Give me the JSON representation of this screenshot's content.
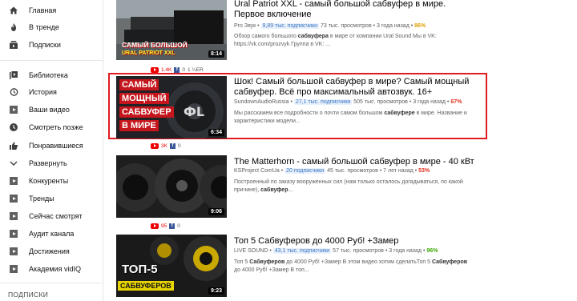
{
  "sidebar": {
    "items": [
      {
        "label": "Главная",
        "icon": "home-icon"
      },
      {
        "label": "В тренде",
        "icon": "fire-icon"
      },
      {
        "label": "Подписки",
        "icon": "subscriptions-icon"
      },
      {
        "label": "Библиотека",
        "icon": "library-icon"
      },
      {
        "label": "История",
        "icon": "history-icon"
      },
      {
        "label": "Ваши видео",
        "icon": "your-videos-icon"
      },
      {
        "label": "Смотреть позже",
        "icon": "clock-icon"
      },
      {
        "label": "Понравившиеся",
        "icon": "thumbs-up-icon"
      },
      {
        "label": "Развернуть",
        "icon": "chevron-down-icon"
      },
      {
        "label": "Конкуренты",
        "icon": "play-square-icon"
      },
      {
        "label": "Тренды",
        "icon": "play-square-icon"
      },
      {
        "label": "Сейчас смотрят",
        "icon": "play-square-icon"
      },
      {
        "label": "Аудит канала",
        "icon": "play-square-icon"
      },
      {
        "label": "Достижения",
        "icon": "play-square-icon"
      },
      {
        "label": "Академия vidIQ",
        "icon": "play-square-icon"
      }
    ],
    "subscriptions_heading": "ПОДПИСКИ"
  },
  "results": [
    {
      "title": "Ural Patriot XXL - самый большой сабвуфер в мире. Первое включение",
      "channel": "Pro Звук",
      "subs": "9,89 тыс. подписчики",
      "views": "73 тыс. просмотров",
      "age": "3 года назад",
      "score": "86%",
      "score_color": "#e0a000",
      "description": "Обзор самого большого <b>сабвуфера</b> в мире от компании Ural Sound Мы в VK: https://vk.com/prozvyk Группа в VK: ...",
      "duration": "8:14",
      "thumb_caption_1": "САМЫЙ БОЛЬШОЙ",
      "thumb_caption_2": "URAL PATRIOT XXL",
      "yt_count": "1.4K",
      "fb_count": "0",
      "extra": "1 ¼ER"
    },
    {
      "title": "Шок! Самый большой сабвуфер в мире? Самый мощный сабвуфер. Всё про максимальный автозвук. 16+",
      "channel": "SundownAudioRussia",
      "subs": "27,1 тыс. подписчики",
      "views": "505 тыс. просмотров",
      "age": "3 года назад",
      "score": "67%",
      "score_color": "#e0301e",
      "description": "Мы расскажем все подробности о почти самом большом <b>сабвуфере</b> в мире. Название и характеристики модели...",
      "duration": "6:34",
      "thumb_caption_1": "САМЫЙ",
      "thumb_caption_2": "МОЩНЫЙ",
      "thumb_caption_3": "САБВУФЕР",
      "thumb_caption_4": "В МИРЕ",
      "yt_count": "3K",
      "fb_count": "0"
    },
    {
      "title": "The Matterhorn - самый большой сабвуфер в мире - 40 кВт",
      "channel": "KSProject ComUa",
      "subs": "20 подписчики",
      "views": "45 тыс. просмотров",
      "age": "7 лет назад",
      "score": "53%",
      "score_color": "#e0301e",
      "description": "Построенный по заказу вооруженных сил (нам только осталось догадываться, по какой причине), <b>сабвуфер</b>...",
      "duration": "9:06",
      "yt_count": "95",
      "fb_count": "0"
    },
    {
      "title": "Топ 5 Сабвуферов до 4000 Руб! +Замер",
      "channel": "LIVE SOUND",
      "subs": "43,1 тыс. подписчики",
      "views": "57 тыс. просмотров",
      "age": "3 года назад",
      "score": "96%",
      "score_color": "#3aa800",
      "description": "Топ 5 <b>Сабвуферов</b> до 4000 Руб! +Замер В этом видео хотим сделатьТоп 5 <b>Сабвуферов</b> до 4000 Руб! +Замер В топ...",
      "duration": "9:23",
      "thumb_caption_1": "ТОП-5",
      "thumb_caption_2": "САБВУФЕРОВ"
    }
  ]
}
